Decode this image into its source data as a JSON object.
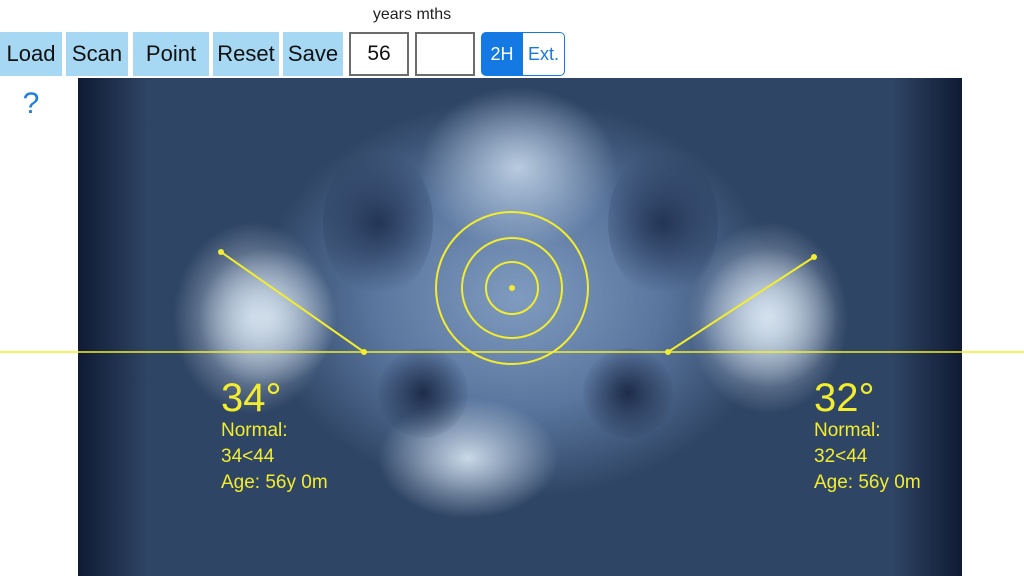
{
  "toolbar": {
    "load_label": "Load",
    "scan_label": "Scan",
    "point_label": "Point",
    "reset_label": "Reset",
    "save_label": "Save"
  },
  "age": {
    "header_label": "years mths",
    "years_value": "56",
    "months_value": ""
  },
  "mode_toggle": {
    "options": [
      "2H",
      "Ext."
    ],
    "selected": "2H"
  },
  "help_label": "?",
  "measurements": {
    "left": {
      "angle": "34°",
      "normal_label": "Normal:",
      "normal_range": "34<44",
      "age_text": "Age: 56y 0m"
    },
    "right": {
      "angle": "32°",
      "normal_label": "Normal:",
      "normal_range": "32<44",
      "age_text": "Age: 56y 0m"
    }
  },
  "colors": {
    "overlay": "#f3ed2e",
    "toolbar_button": "#a7d8f3",
    "accent": "#1479e3"
  }
}
